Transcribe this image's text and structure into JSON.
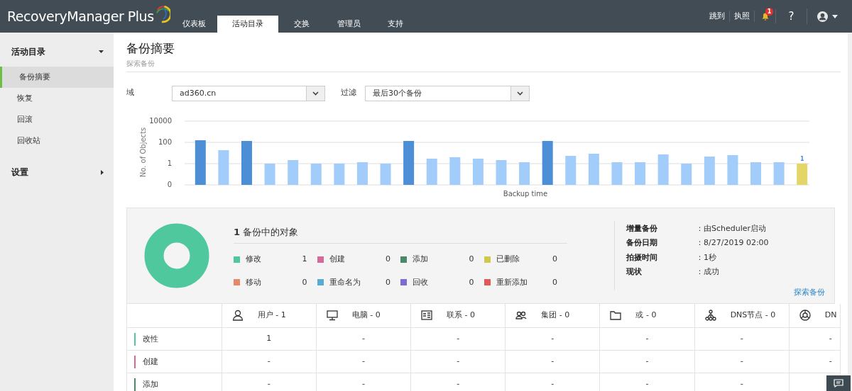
{
  "header": {
    "brand": "RecoveryManager Plus",
    "tabs": [
      {
        "label": "仪表板",
        "selected": false
      },
      {
        "label": "活动目录",
        "selected": true
      },
      {
        "label": "交换",
        "selected": false
      },
      {
        "label": "管理员",
        "selected": false
      },
      {
        "label": "支持",
        "selected": false
      }
    ],
    "links": [
      "跳到",
      "执照"
    ],
    "notification_count": "1",
    "help": "?"
  },
  "sidebar": {
    "sections": [
      {
        "label": "活动目录",
        "expanded": true,
        "items": [
          {
            "label": "备份摘要",
            "selected": true
          },
          {
            "label": "恢复",
            "selected": false
          },
          {
            "label": "回滚",
            "selected": false
          },
          {
            "label": "回收站",
            "selected": false
          }
        ]
      },
      {
        "label": "设置",
        "expanded": false
      }
    ]
  },
  "page": {
    "title": "备份摘要",
    "subtitle": "探索备份"
  },
  "filters": [
    {
      "label": "域",
      "value": "ad360.cn"
    },
    {
      "label": "过滤",
      "value": "最后30个备份"
    }
  ],
  "chart": {
    "ylabel": "No. of Objects",
    "xlabel": "Backup time",
    "y_labels": [
      "10000",
      "100",
      "1",
      "0"
    ],
    "bar_label": "1"
  },
  "summary": {
    "count": "1",
    "heading": "备份中的对象",
    "legend": [
      {
        "label": "修改",
        "value": "1",
        "color": "#4fc89d"
      },
      {
        "label": "创建",
        "value": "0",
        "color": "#d4699a"
      },
      {
        "label": "添加",
        "value": "0",
        "color": "#4a8a68"
      },
      {
        "label": "已删除",
        "value": "0",
        "color": "#cfc94b"
      },
      {
        "label": "移动",
        "value": "0",
        "color": "#e8876a"
      },
      {
        "label": "重命名为",
        "value": "0",
        "color": "#58abd1"
      },
      {
        "label": "回收",
        "value": "0",
        "color": "#7d6bd3"
      },
      {
        "label": "重新添加",
        "value": "0",
        "color": "#e15a5a"
      }
    ],
    "details": [
      {
        "label": "增量备份",
        "value": "：由Scheduler启动"
      },
      {
        "label": "备份日期",
        "value": "：8/27/2019 02:00"
      },
      {
        "label": "拍摄时间",
        "value": "：1秒"
      },
      {
        "label": "现状",
        "value": "：成功"
      }
    ],
    "link": "探索备份"
  },
  "table": {
    "columns": [
      "用户 - 1",
      "电脑 - 0",
      "联系 - 0",
      "集团 - 0",
      "或 - 0",
      "DNS节点 - 0",
      "DN"
    ],
    "rows": [
      {
        "label": "改性",
        "color": "#4fc89d",
        "cells": [
          "1",
          "-",
          "-",
          "-",
          "-",
          "-",
          "-"
        ]
      },
      {
        "label": "创建",
        "color": "#d4699a",
        "cells": [
          "-",
          "-",
          "-",
          "-",
          "-",
          "-",
          "-"
        ]
      },
      {
        "label": "添加",
        "color": "#4a8a68",
        "cells": [
          "-",
          "-",
          "-",
          "-",
          "-",
          "-"
        ]
      }
    ]
  }
}
